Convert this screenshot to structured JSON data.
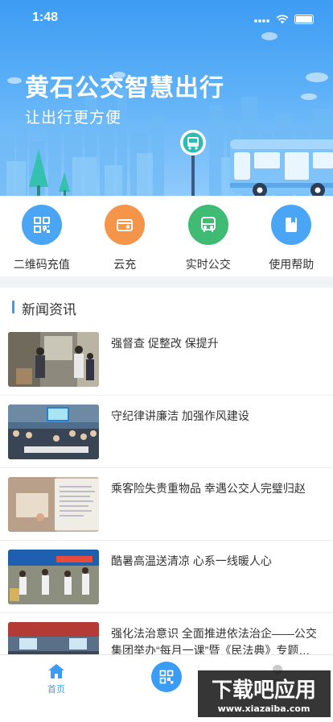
{
  "status_bar": {
    "time": "1:48"
  },
  "banner": {
    "title": "黄石公交智慧出行",
    "subtitle": "让出行更方便",
    "colors": {
      "sky_top": "#3d9cf3",
      "sky_bottom": "#8fcafb",
      "bus_body": "#7fc3f8"
    }
  },
  "quick_actions": [
    {
      "label": "二维码充值",
      "icon": "qr-code-icon",
      "color": "#4aa6f4"
    },
    {
      "label": "云充",
      "icon": "wallet-icon",
      "color": "#f5954a"
    },
    {
      "label": "实时公交",
      "icon": "bus-icon",
      "color": "#3fbb73"
    },
    {
      "label": "使用帮助",
      "icon": "book-icon",
      "color": "#4aa6f4"
    }
  ],
  "news": {
    "section_title": "新闻资讯",
    "accent": "#3b9cf5",
    "items": [
      {
        "title": "强督查 促整改 保提升",
        "thumb": "inspection-photo"
      },
      {
        "title": "守纪律讲廉洁 加强作风建设",
        "thumb": "meeting-room-photo"
      },
      {
        "title": "乘客险失贵重物品 幸遇公交人完璧归赵",
        "thumb": "letter-photo"
      },
      {
        "title": "酷暑高温送清凉 心系一线暖人心",
        "thumb": "outdoor-event-photo"
      },
      {
        "title": "强化法治意识 全面推进依法治企——公交集团举办“每月一课”暨《民法典》专题…",
        "thumb": "lecture-photo"
      }
    ]
  },
  "tabbar": {
    "home_label": "首页",
    "home_icon": "home-icon",
    "center_icon": "qr-code-icon",
    "profile_icon": "person-icon"
  },
  "watermark": {
    "brand": "下载吧应用",
    "url": "www.xiazaiba.com"
  }
}
